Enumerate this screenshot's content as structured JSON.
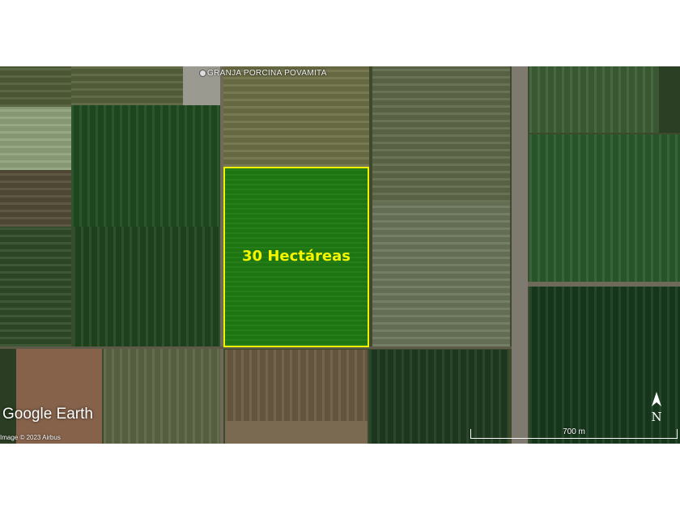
{
  "map": {
    "farm_label": "GRANJA PORCINA POVAMITA",
    "area_label": "30 Hectáreas",
    "logo": "Google Earth",
    "credit": "Image © 2023 Airbus",
    "scale_label": "700 m",
    "north_label": "N",
    "highlight_color": "#f2f200",
    "area_text_color": "#f5f500"
  }
}
